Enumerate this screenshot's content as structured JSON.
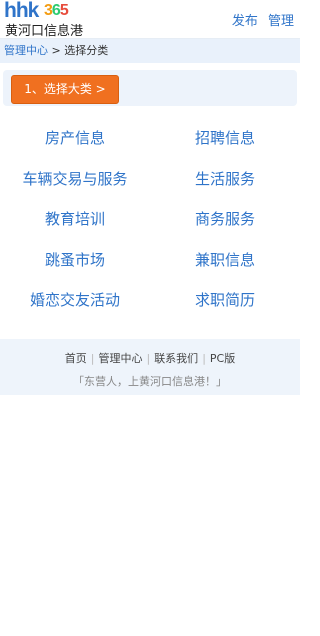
{
  "header": {
    "logo_brand": "hhk",
    "logo_digits": [
      "3",
      "6",
      "5"
    ],
    "logo_subtitle": "黄河口信息港",
    "links": [
      "发布",
      "管理"
    ]
  },
  "breadcrumb": {
    "home": "管理中心",
    "separator": " > ",
    "current": "选择分类"
  },
  "step_button": "1、选择大类 >",
  "categories": [
    [
      "房产信息",
      "招聘信息"
    ],
    [
      "车辆交易与服务",
      "生活服务"
    ],
    [
      "教育培训",
      "商务服务"
    ],
    [
      "跳蚤市场",
      "兼职信息"
    ],
    [
      "婚恋交友活动",
      "求职简历"
    ]
  ],
  "footer": {
    "links": [
      "首页",
      "管理中心",
      "联系我们",
      "PC版"
    ],
    "separator": "|",
    "slogan": "「东营人，上黄河口信息港！」"
  },
  "colors": {
    "link_blue": "#2f74c9",
    "button_orange": "#f07020",
    "panel_bg": "#edf3fb"
  }
}
